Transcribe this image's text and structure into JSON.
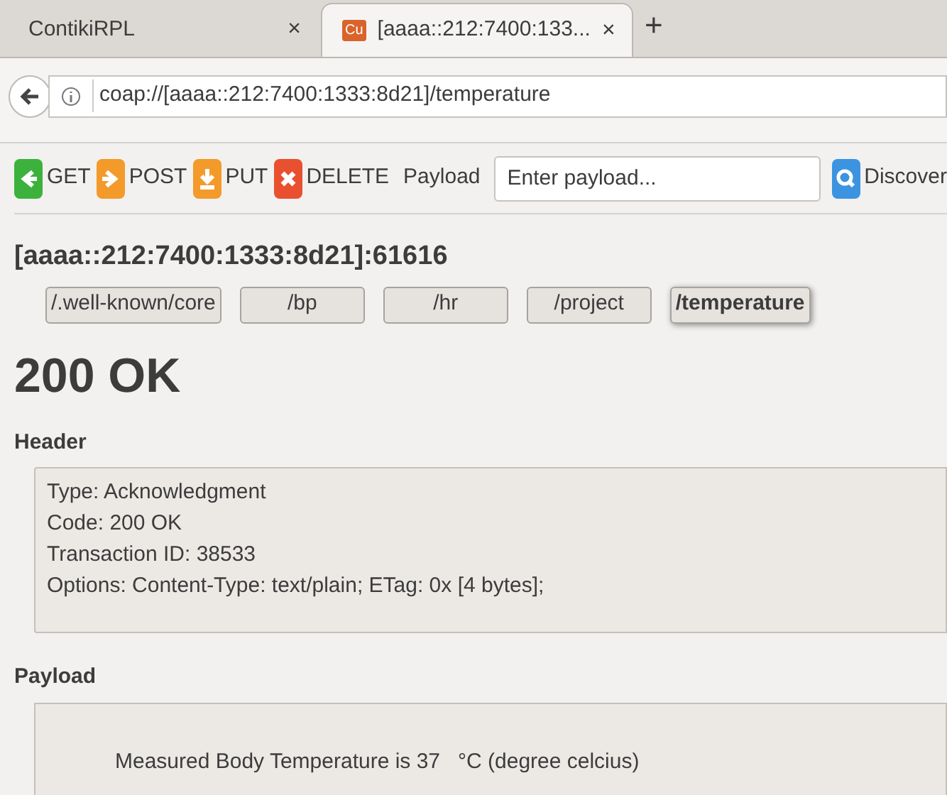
{
  "tabs": [
    {
      "label": "ContikiRPL",
      "selected": false,
      "close": "×"
    },
    {
      "label": "[aaaa::212:7400:133...",
      "selected": true,
      "close": "×",
      "favicon": "Cu"
    }
  ],
  "new_tab": "+",
  "address_bar": {
    "url": "coap://[aaaa::212:7400:1333:8d21]/temperature"
  },
  "toolbar": {
    "methods": [
      {
        "kind": "get",
        "label": "GET"
      },
      {
        "kind": "post",
        "label": "POST"
      },
      {
        "kind": "put",
        "label": "PUT"
      },
      {
        "kind": "delete",
        "label": "DELETE"
      }
    ],
    "payload_label": "Payload",
    "payload_placeholder": "Enter payload...",
    "discover": "Discover"
  },
  "endpoint": "[aaaa::212:7400:1333:8d21]:61616",
  "resources": [
    {
      "label": "/.well-known/core",
      "selected": false
    },
    {
      "label": "/bp",
      "selected": false
    },
    {
      "label": "/hr",
      "selected": false
    },
    {
      "label": "/project",
      "selected": false
    },
    {
      "label": "/temperature",
      "selected": true
    }
  ],
  "status": "200 OK",
  "header": {
    "title": "Header",
    "lines": [
      "Type: Acknowledgment",
      "Code: 200 OK",
      "Transaction ID: 38533",
      "Options: Content-Type: text/plain; ETag: 0x [4 bytes];"
    ]
  },
  "payload": {
    "title": "Payload",
    "text": "Measured Body Temperature is 37   °C (degree celcius)"
  }
}
